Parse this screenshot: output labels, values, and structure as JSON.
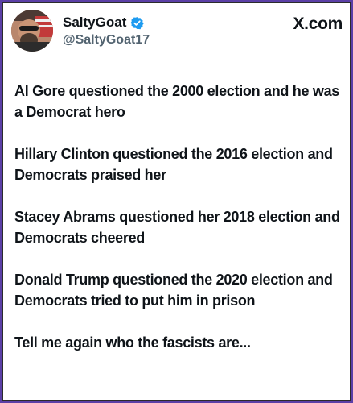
{
  "profile": {
    "display_name": "SaltyGoat",
    "handle": "@SaltyGoat17",
    "verified_icon": "verified-badge-icon",
    "verified_color": "#1d9bf0"
  },
  "brand": "X.com",
  "paragraphs": [
    "Al Gore questioned the 2000 election and he was a Democrat hero",
    "Hillary Clinton questioned the 2016 election and Democrats praised her",
    "Stacey Abrams questioned her 2018 election and Democrats cheered",
    "Donald Trump questioned the 2020 election and Democrats tried to put him in prison",
    "Tell me again who the fascists are..."
  ],
  "colors": {
    "border": "#5b3fa6",
    "text": "#0f1419",
    "muted": "#536471"
  }
}
